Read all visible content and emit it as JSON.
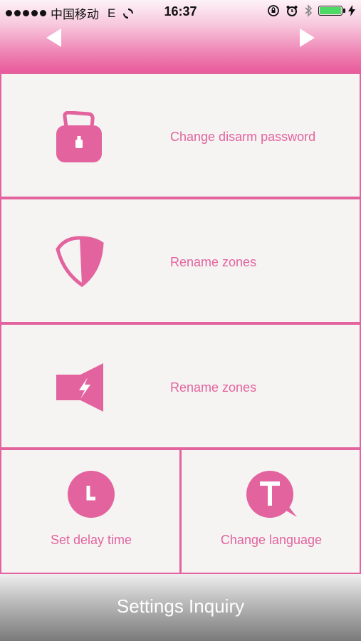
{
  "status_bar": {
    "carrier": "中国移动",
    "network": "E",
    "time": "16:37"
  },
  "nav": {
    "prev_icon": "left-arrow-icon",
    "next_icon": "right-arrow-icon"
  },
  "menu": {
    "password": {
      "label": "Change disarm password",
      "icon": "lock-icon"
    },
    "zones": {
      "label": "Rename zones",
      "icon": "shield-icon"
    },
    "siren": {
      "label": "Rename zones",
      "icon": "siren-icon"
    },
    "delay": {
      "label": "Set delay time",
      "icon": "clock-icon"
    },
    "language": {
      "label": "Change language",
      "icon": "language-t-icon"
    }
  },
  "footer": {
    "title": "Settings Inquiry"
  },
  "colors": {
    "accent": "#e3639f",
    "background": "#f5f4f2",
    "battery": "#4cd964"
  }
}
